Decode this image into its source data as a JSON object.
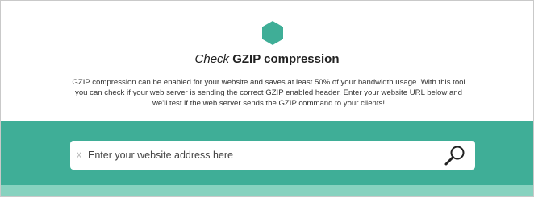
{
  "title": {
    "prefix": "Check",
    "main": "GZIP compression"
  },
  "description": "GZIP compression can be enabled for your website and saves at least 50% of your bandwidth usage. With this tool you can check if your web server is sending the correct GZIP enabled header. Enter your website URL below and we'll test if the web server sends the GZIP command to your clients!",
  "search": {
    "placeholder": "Enter your website address here",
    "value": "",
    "clear_label": "x"
  },
  "colors": {
    "accent": "#3fae97",
    "accent_light": "#87d2bf"
  },
  "icons": {
    "logo": "hexagon-icon",
    "search": "magnifier-icon"
  }
}
